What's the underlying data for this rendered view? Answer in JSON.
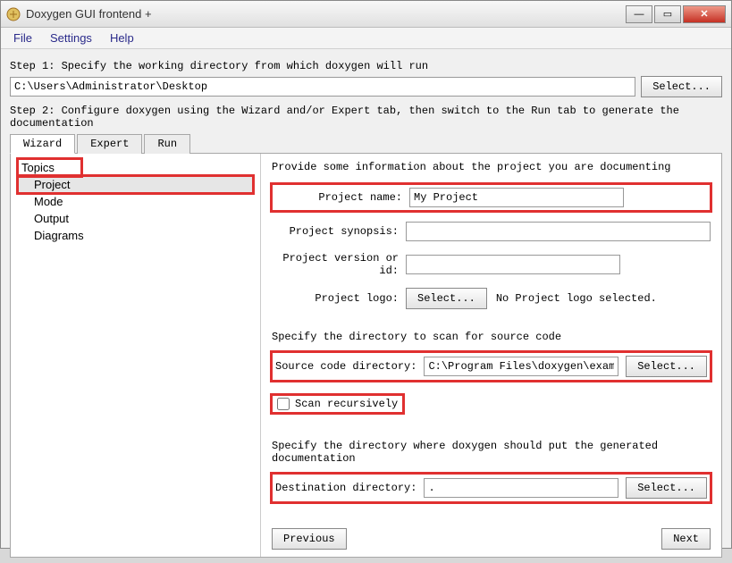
{
  "window": {
    "title": "Doxygen GUI frontend +"
  },
  "menu": {
    "file": "File",
    "settings": "Settings",
    "help": "Help"
  },
  "step1": {
    "label": "Step 1: Specify the working directory from which doxygen will run",
    "path": "C:\\Users\\Administrator\\Desktop",
    "select": "Select..."
  },
  "step2": {
    "label": "Step 2: Configure doxygen using the Wizard and/or Expert tab, then switch to the Run tab to generate the documentation"
  },
  "tabs": {
    "wizard": "Wizard",
    "expert": "Expert",
    "run": "Run"
  },
  "topics": {
    "header": "Topics",
    "items": [
      "Project",
      "Mode",
      "Output",
      "Diagrams"
    ]
  },
  "main": {
    "intro": "Provide some information about the project you are documenting",
    "project_name_label": "Project name:",
    "project_name": "My Project",
    "synopsis_label": "Project synopsis:",
    "synopsis": "",
    "version_label": "Project version or id:",
    "version": "",
    "logo_label": "Project logo:",
    "logo_select": "Select...",
    "logo_status": "No Project logo selected.",
    "src_label": "Specify the directory to scan for source code",
    "srcdir_label": "Source code directory:",
    "srcdir": "C:\\Program Files\\doxygen\\examples",
    "srcdir_select": "Select...",
    "scan_recursive": "Scan recursively",
    "dest_label": "Specify the directory where doxygen should put the generated documentation",
    "destdir_label": "Destination directory:",
    "destdir": ".",
    "destdir_select": "Select...",
    "prev": "Previous",
    "next": "Next"
  }
}
